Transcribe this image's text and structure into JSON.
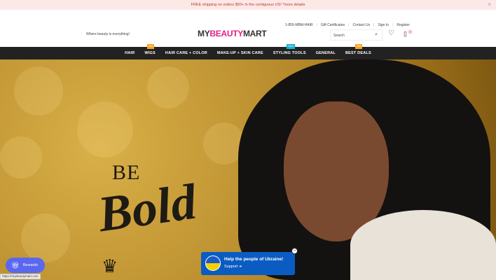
{
  "promo": {
    "text": "FREE shipping on orders $50+ in the contiguous US! *more details",
    "close": "×"
  },
  "toplinks": [
    "1-855-MBM-HAIR",
    "Gift Certificates",
    "Contact Us",
    "Sign In",
    "Register"
  ],
  "header": {
    "tagline": "Where beauty is everything!",
    "logo_a": "MY",
    "logo_b": "BEAUTY",
    "logo_c": "MART",
    "search_placeholder": "Search",
    "cart_count": "0"
  },
  "nav": [
    {
      "label": "HAIR"
    },
    {
      "label": "WIGS",
      "badge": "Hot",
      "badge_color": "#f5a623"
    },
    {
      "label": "HAIR CARE + COLOR"
    },
    {
      "label": "MAKE-UP + SKIN CARE"
    },
    {
      "label": "STYLING TOOLS",
      "badge": "New",
      "badge_color": "#1ab0d8"
    },
    {
      "label": "GENERAL"
    },
    {
      "label": "BEST DEALS",
      "badge": "Hot",
      "badge_color": "#f5a623"
    }
  ],
  "hero": {
    "line1": "BE",
    "line2": "Bold"
  },
  "rewards": {
    "label": "Rewards"
  },
  "ukraine": {
    "title": "Help the people of Ukraine!",
    "link": "Support ➔"
  },
  "status_url": "https://mybeautymart.com"
}
